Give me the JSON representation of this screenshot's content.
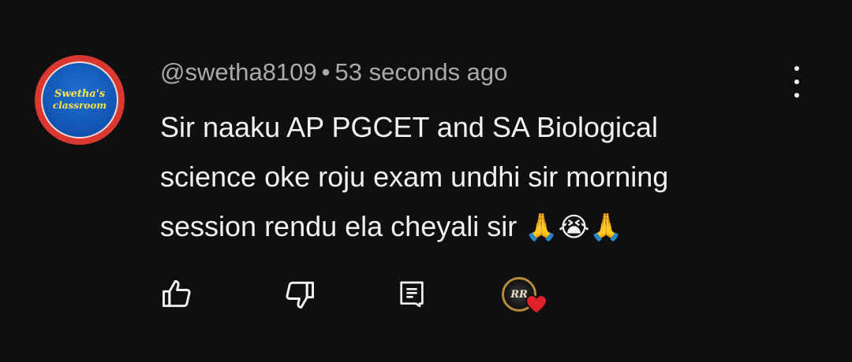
{
  "comment": {
    "avatar": {
      "line1": "Swetha's",
      "line2": "classroom"
    },
    "author": "@swetha8109",
    "separator": "•",
    "time": "53 seconds ago",
    "text_lines": [
      "Sir naaku AP PGCET and SA Biological",
      "science oke roju exam undhi sir morning",
      "session rendu ela cheyali sir"
    ],
    "emojis": [
      "🙏",
      "😭",
      "🙏"
    ],
    "icons": {
      "like": "thumb-up-icon",
      "dislike": "thumb-down-icon",
      "reply": "comment-icon",
      "menu": "more-vert-icon",
      "creator_heart": "heart-icon"
    },
    "creator_avatar_text": "RR",
    "colors": {
      "background": "#0f0f0f",
      "meta_text": "#aaaaaa",
      "body_text": "#f1f1f1",
      "heart": "#e0202b"
    }
  }
}
